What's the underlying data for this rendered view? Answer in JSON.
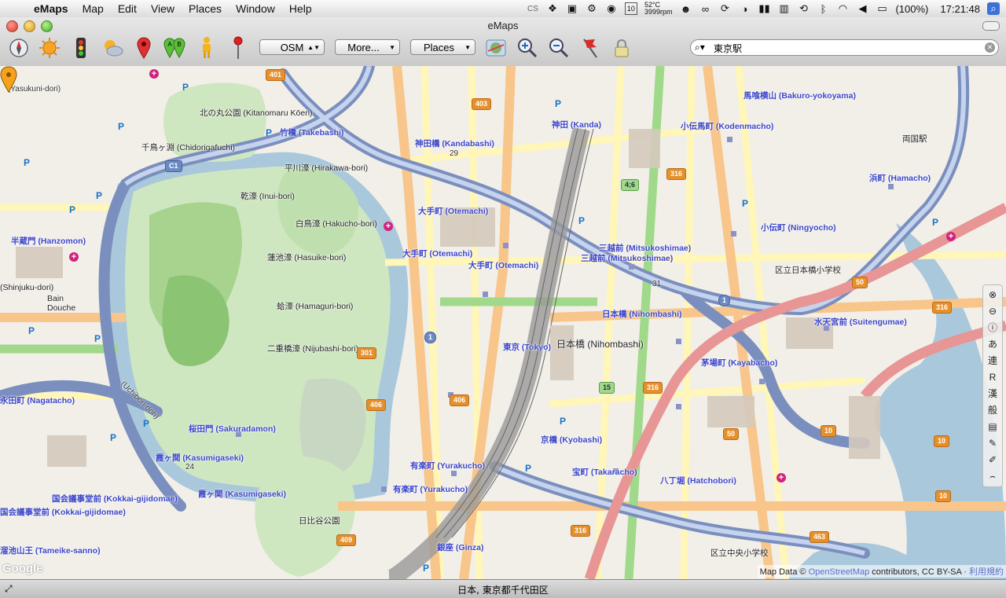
{
  "menubar": {
    "app": "eMaps",
    "items": [
      "Map",
      "Edit",
      "View",
      "Places",
      "Window",
      "Help"
    ],
    "temp": "52°C",
    "rpm": "3999rpm",
    "calendar_day": "10",
    "battery": "(100%)",
    "clock": "17:21:48"
  },
  "window": {
    "title": "eMaps"
  },
  "toolbar": {
    "map_type": "OSM",
    "more": "More...",
    "places": "Places",
    "search_value": "東京駅",
    "search_placeholder": ""
  },
  "map": {
    "credit_prefix": "Map Data ©",
    "credit_link": "OpenStreetMap",
    "credit_suffix": "contributors, CC BY-SA ·",
    "credit_terms": "利用規約",
    "google": "Google",
    "labels": [
      {
        "t": "神田 (Kanda)",
        "c": "blue"
      },
      {
        "t": "小伝馬町 (Kodenmacho)",
        "c": "blue"
      },
      {
        "t": "馬喰横山 (Bakuro-yokoyama)",
        "c": "blue"
      },
      {
        "t": "竹橋 (Takebashi)",
        "c": "blue"
      },
      {
        "t": "神田橋 (Kandabashi)",
        "c": "blue"
      },
      {
        "t": "大手町 (Otemachi)",
        "c": "blue"
      },
      {
        "t": "大手町 (Otemachi)",
        "c": "blue"
      },
      {
        "t": "大手町 (Otemachi)",
        "c": "blue"
      },
      {
        "t": "三越前 (Mitsukoshimae)",
        "c": "blue"
      },
      {
        "t": "三越前 (Mitsukoshimae)",
        "c": "blue"
      },
      {
        "t": "小伝町 (Ningyocho)",
        "c": "blue"
      },
      {
        "t": "浜町 (Hamacho)",
        "c": "blue"
      },
      {
        "t": "日本橋 (Nihombashi)",
        "c": "blue"
      },
      {
        "t": "日本橋 (Nihombashi)",
        "c": "dark"
      },
      {
        "t": "東京 (Tokyo)",
        "c": "blue"
      },
      {
        "t": "茅場町 (Kayabacho)",
        "c": "blue"
      },
      {
        "t": "水天宮前 (Suitengumae)",
        "c": "blue"
      },
      {
        "t": "京橋 (Kyobashi)",
        "c": "blue"
      },
      {
        "t": "宝町 (Takaracho)",
        "c": "blue"
      },
      {
        "t": "八丁堀 (Hatchobori)",
        "c": "blue"
      },
      {
        "t": "有楽町 (Yurakucho)",
        "c": "blue"
      },
      {
        "t": "有楽町 (Yurakucho)",
        "c": "blue"
      },
      {
        "t": "銀座 (Ginza)",
        "c": "blue"
      },
      {
        "t": "桜田門 (Sakuradamon)",
        "c": "blue"
      },
      {
        "t": "霞ヶ関 (Kasumigaseki)",
        "c": "blue"
      },
      {
        "t": "霞ヶ関 (Kasumigaseki)",
        "c": "blue"
      },
      {
        "t": "国会議事堂前 (Kokkai-gijidomae)",
        "c": "blue"
      },
      {
        "t": "国会議事堂前 (Kokkai-gijidomae)",
        "c": "blue"
      },
      {
        "t": "溜池山王 (Tameike-sanno)",
        "c": "blue"
      },
      {
        "t": "半蔵門 (Hanzomon)",
        "c": "blue"
      },
      {
        "t": "永田町 (Nagatacho)",
        "c": "blue"
      },
      {
        "t": "北の丸公園 (Kitanomaru Kōen)",
        "c": "dark"
      },
      {
        "t": "千鳥ヶ淵 (Chidorigafuchi)",
        "c": "dark"
      },
      {
        "t": "平川濠 (Hirakawa-bori)",
        "c": "dark"
      },
      {
        "t": "乾濠 (Inui-bori)",
        "c": "dark"
      },
      {
        "t": "白鳥濠 (Hakucho-bori)",
        "c": "dark"
      },
      {
        "t": "蓮池濠 (Hasuike-bori)",
        "c": "dark"
      },
      {
        "t": "蛤濠 (Hamaguri-bori)",
        "c": "dark"
      },
      {
        "t": "二重橋濠 (Nijubashi-bori)",
        "c": "dark"
      },
      {
        "t": "両国駅",
        "c": "dark"
      },
      {
        "t": "区立日本橋小学校",
        "c": "dark"
      },
      {
        "t": "日比谷公園",
        "c": "dark"
      },
      {
        "t": "区立中央小学校",
        "c": "dark"
      },
      {
        "t": "(Shinjuku-dori)",
        "c": "dark"
      },
      {
        "t": "Bain Douche",
        "c": "dark"
      },
      {
        "t": "(Uchibori-dori)",
        "c": "dark"
      },
      {
        "t": "(Yasukuni-dori)",
        "c": "dark"
      }
    ],
    "shields": [
      "401",
      "403",
      "316",
      "316",
      "316",
      "316",
      "301",
      "406",
      "406",
      "409",
      "50",
      "50",
      "10",
      "10",
      "10",
      "463",
      "1",
      "1",
      "4;6",
      "15",
      "29",
      "24",
      "31",
      "C1"
    ]
  },
  "status": {
    "address": "日本, 東京都千代田区"
  }
}
